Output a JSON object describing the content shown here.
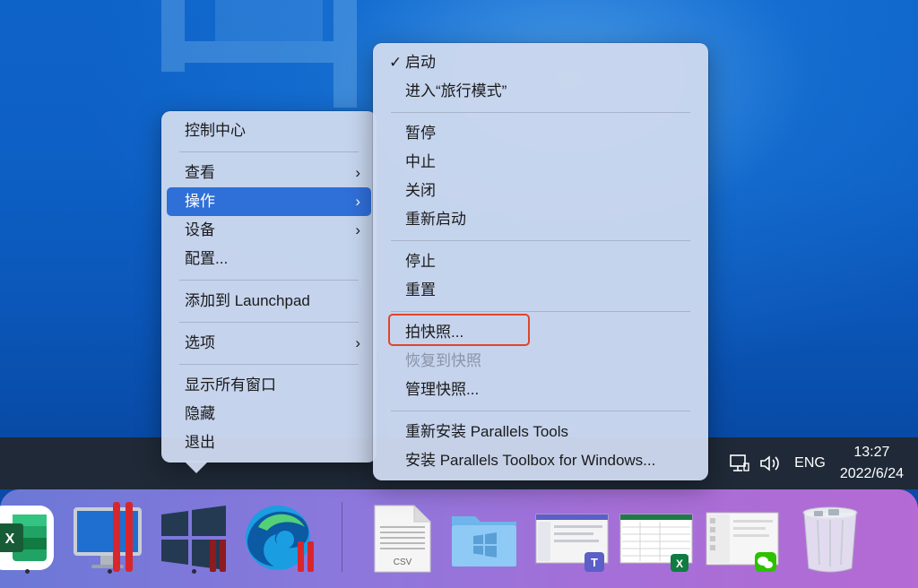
{
  "context_menu": {
    "items": [
      {
        "label": "控制中心"
      },
      {
        "label": "查看",
        "chevron": "›"
      },
      {
        "label": "操作",
        "chevron": "›"
      },
      {
        "label": "设备",
        "chevron": "›"
      },
      {
        "label": "配置..."
      },
      {
        "label": "添加到 Launchpad"
      },
      {
        "label": "选项",
        "chevron": "›"
      },
      {
        "label": "显示所有窗口"
      },
      {
        "label": "隐藏"
      },
      {
        "label": "退出"
      }
    ]
  },
  "submenu": {
    "check_mark": "✓",
    "items": [
      {
        "label": "启动",
        "checked": true
      },
      {
        "label": "进入“旅行模式”"
      },
      {
        "label": "暂停"
      },
      {
        "label": "中止"
      },
      {
        "label": "关闭"
      },
      {
        "label": "重新启动"
      },
      {
        "label": "停止"
      },
      {
        "label": "重置"
      },
      {
        "label": "拍快照...",
        "highlighted": true
      },
      {
        "label": "恢复到快照",
        "disabled": true
      },
      {
        "label": "管理快照..."
      },
      {
        "label": "重新安装 Parallels Tools"
      },
      {
        "label": "安装 Parallels Toolbox for Windows..."
      }
    ]
  },
  "taskbar": {
    "language": "ENG",
    "time": "13:27",
    "date": "2022/6/24"
  },
  "dock": {
    "items": [
      {
        "name": "excel-icon"
      },
      {
        "name": "parallels-desktop-icon"
      },
      {
        "name": "windows-10-icon"
      },
      {
        "name": "edge-icon"
      },
      {
        "name": "csv-file-icon",
        "badge": "CSV"
      },
      {
        "name": "windows-folder-icon"
      },
      {
        "name": "teams-window-preview"
      },
      {
        "name": "excel-window-preview"
      },
      {
        "name": "wechat-window-preview"
      },
      {
        "name": "trash-icon"
      }
    ]
  },
  "colors": {
    "selection": "#2f6fd8",
    "highlight_box": "#e0452c",
    "taskbar": "#1f2937"
  }
}
